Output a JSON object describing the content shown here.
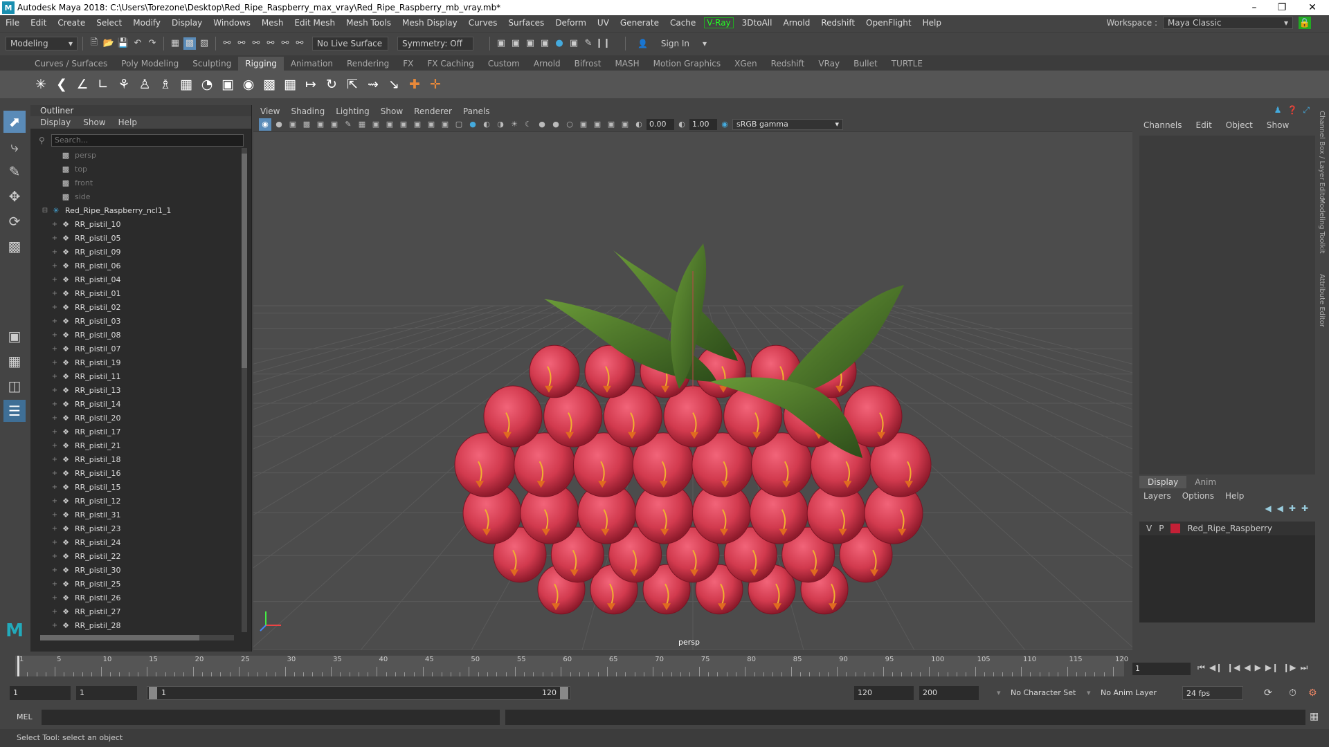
{
  "window": {
    "title": "Autodesk Maya 2018: C:\\Users\\Torezone\\Desktop\\Red_Ripe_Raspberry_max_vray\\Red_Ripe_Raspberry_mb_vray.mb*"
  },
  "menubar": [
    "File",
    "Edit",
    "Create",
    "Select",
    "Modify",
    "Display",
    "Windows",
    "Mesh",
    "Edit Mesh",
    "Mesh Tools",
    "Mesh Display",
    "Curves",
    "Surfaces",
    "Deform",
    "UV",
    "Generate",
    "Cache",
    "V-Ray",
    "3DtoAll",
    "Arnold",
    "Redshift",
    "OpenFlight",
    "Help"
  ],
  "workspace": {
    "label": "Workspace :",
    "value": "Maya Classic"
  },
  "statusline": {
    "mode": "Modeling",
    "live_surface": "No Live Surface",
    "symmetry": "Symmetry: Off",
    "sign_in": "Sign In"
  },
  "shelf_tabs": [
    "Curves / Surfaces",
    "Poly Modeling",
    "Sculpting",
    "Rigging",
    "Animation",
    "Rendering",
    "FX",
    "FX Caching",
    "Custom",
    "Arnold",
    "Bifrost",
    "MASH",
    "Motion Graphics",
    "XGen",
    "Redshift",
    "VRay",
    "Bullet",
    "TURTLE"
  ],
  "shelf_active": "Rigging",
  "outliner": {
    "title": "Outliner",
    "menus": [
      "Display",
      "Show",
      "Help"
    ],
    "search_placeholder": "Search...",
    "cameras": [
      "persp",
      "top",
      "front",
      "side"
    ],
    "group": "Red_Ripe_Raspberry_ncl1_1",
    "items": [
      "RR_pistil_10",
      "RR_pistil_05",
      "RR_pistil_09",
      "RR_pistil_06",
      "RR_pistil_04",
      "RR_pistil_01",
      "RR_pistil_02",
      "RR_pistil_03",
      "RR_pistil_08",
      "RR_pistil_07",
      "RR_pistil_19",
      "RR_pistil_11",
      "RR_pistil_13",
      "RR_pistil_14",
      "RR_pistil_20",
      "RR_pistil_17",
      "RR_pistil_21",
      "RR_pistil_18",
      "RR_pistil_16",
      "RR_pistil_15",
      "RR_pistil_12",
      "RR_pistil_31",
      "RR_pistil_23",
      "RR_pistil_24",
      "RR_pistil_22",
      "RR_pistil_30",
      "RR_pistil_25",
      "RR_pistil_26",
      "RR_pistil_27",
      "RR_pistil_28"
    ]
  },
  "viewport": {
    "menus": [
      "View",
      "Shading",
      "Lighting",
      "Show",
      "Renderer",
      "Panels"
    ],
    "exposure": "0.00",
    "gamma": "1.00",
    "color_mgmt": "sRGB gamma",
    "camera_label": "persp"
  },
  "channels": {
    "menus": [
      "Channels",
      "Edit",
      "Object",
      "Show"
    ]
  },
  "layers": {
    "tabs": [
      "Display",
      "Anim"
    ],
    "menus": [
      "Layers",
      "Options",
      "Help"
    ],
    "row": {
      "v": "V",
      "p": "P",
      "name": "Red_Ripe_Raspberry",
      "color": "#c42036"
    }
  },
  "side_tabs": [
    "Channel Box / Layer Editor",
    "Modeling Toolkit",
    "Attribute Editor"
  ],
  "timeline": {
    "ticks": [
      5,
      10,
      15,
      20,
      25,
      30,
      35,
      40,
      45,
      50,
      55,
      60,
      65,
      70,
      75,
      80,
      85,
      90,
      95,
      100,
      105,
      110,
      115,
      120
    ],
    "start_label": "1",
    "current_frame": "1"
  },
  "range": {
    "start": "1",
    "playback_start": "1",
    "slider_start": "1",
    "slider_end": "120",
    "playback_end": "120",
    "end": "200",
    "character_set": "No Character Set",
    "anim_layer": "No Anim Layer",
    "fps": "24 fps"
  },
  "cmdline": {
    "label": "MEL"
  },
  "helpline": {
    "text": "Select Tool: select an object"
  },
  "colors": {
    "accent": "#5a8bb8",
    "raspberry": "#d23a4e",
    "leaf": "#4f7a2a"
  }
}
